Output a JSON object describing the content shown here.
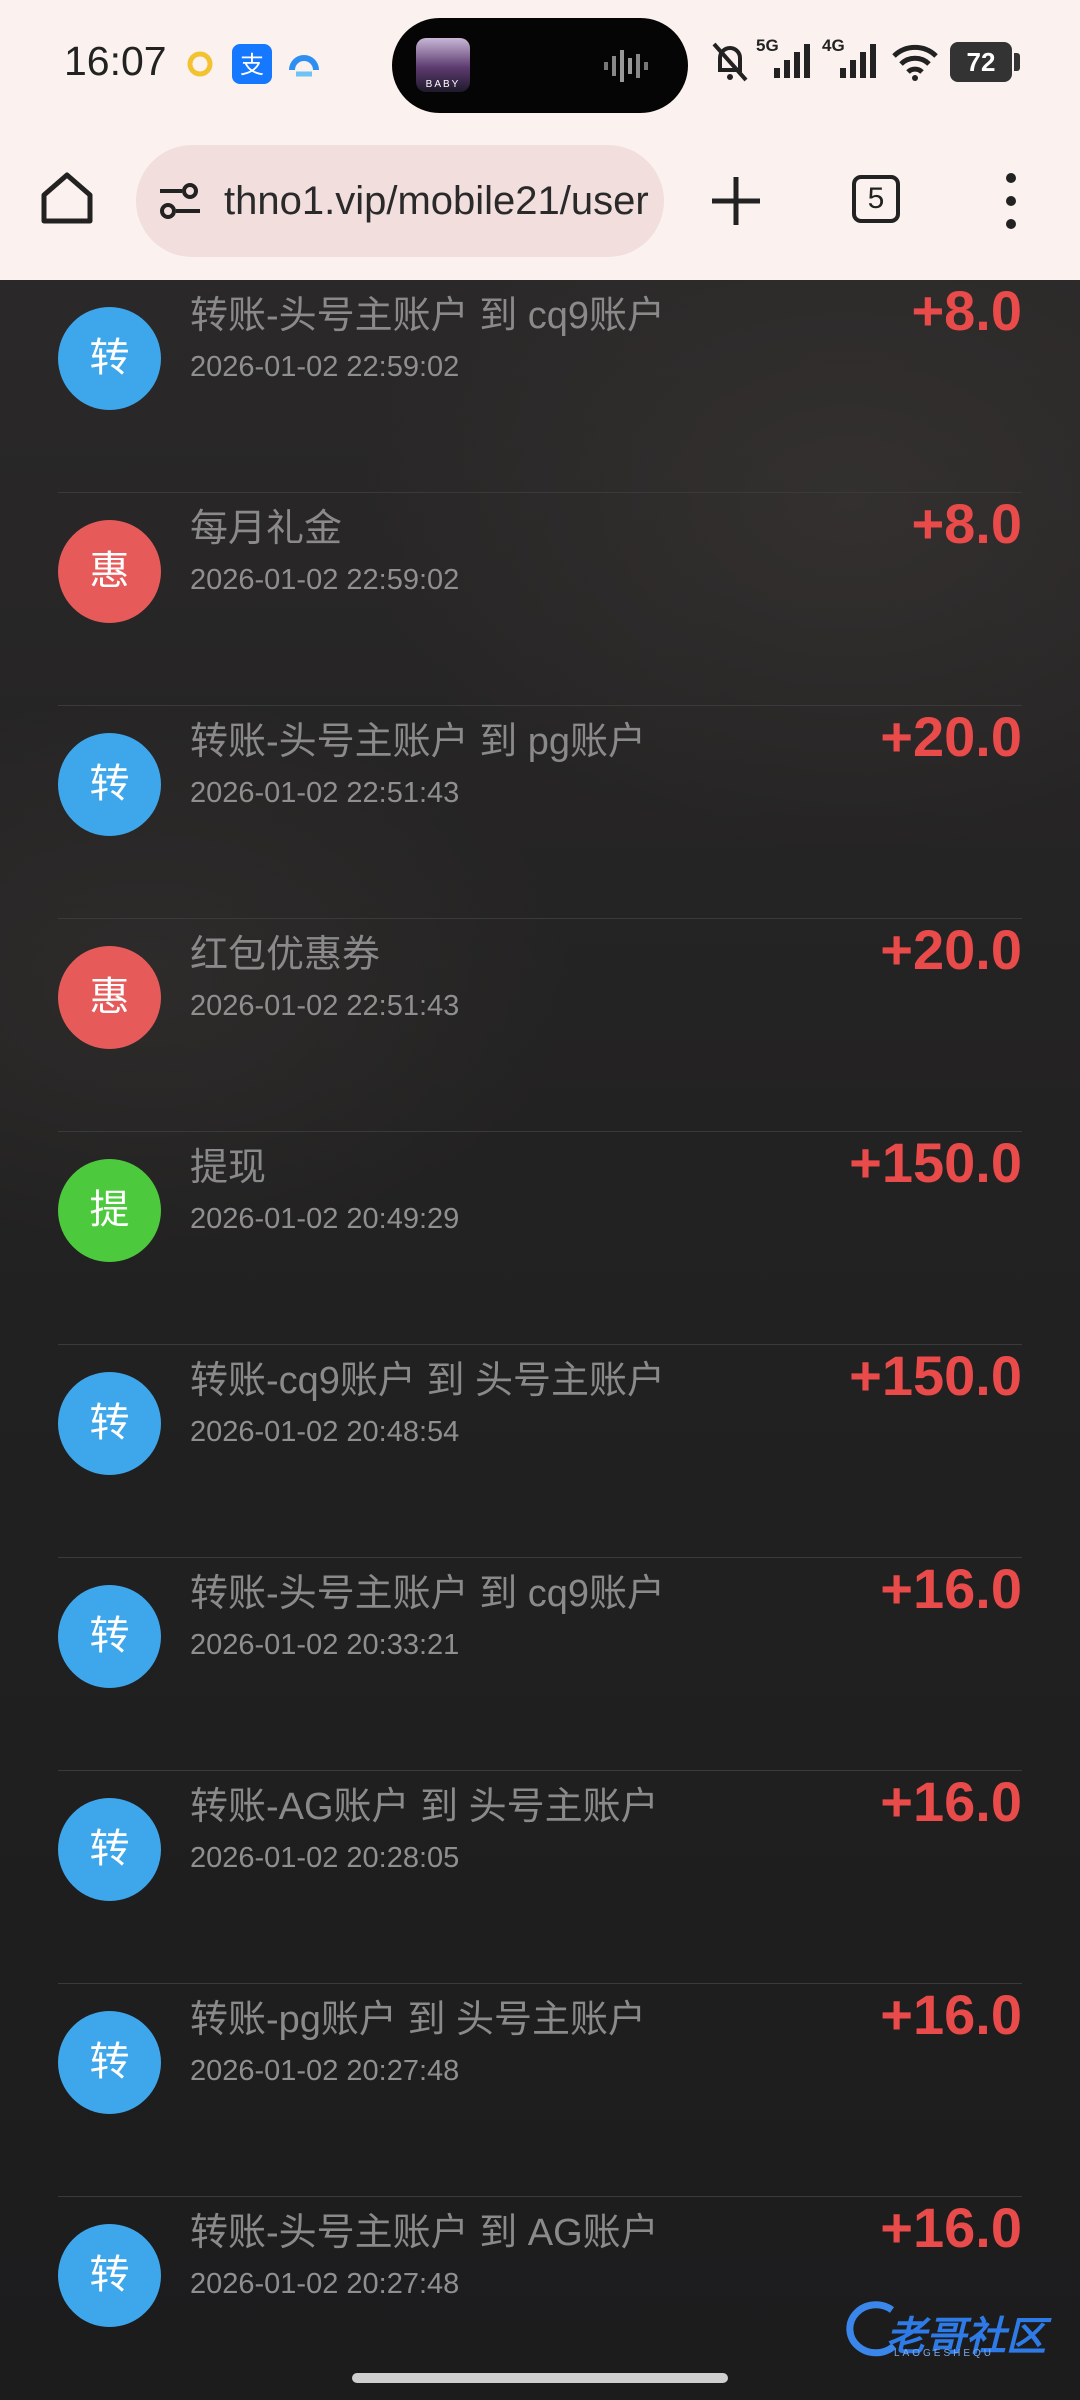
{
  "status_bar": {
    "time": "16:07",
    "island_thumb_label": "BABY",
    "network_1": "5G",
    "network_2": "4G",
    "battery": "72"
  },
  "browser": {
    "url": "thno1.vip/mobile21/user",
    "tab_count": "5"
  },
  "colors": {
    "transfer": "#3ea6ea",
    "promo": "#e65a5a",
    "withdraw": "#4cc93c",
    "amount": "#e94a4a"
  },
  "transactions": [
    {
      "icon": "转",
      "type": "transfer",
      "title": "转账-头号主账户 到 cq9账户",
      "time": "2026-01-02 22:59:02",
      "amount": "+8.0"
    },
    {
      "icon": "惠",
      "type": "promo",
      "title": "每月礼金",
      "time": "2026-01-02 22:59:02",
      "amount": "+8.0"
    },
    {
      "icon": "转",
      "type": "transfer",
      "title": "转账-头号主账户 到 pg账户",
      "time": "2026-01-02 22:51:43",
      "amount": "+20.0"
    },
    {
      "icon": "惠",
      "type": "promo",
      "title": "红包优惠券",
      "time": "2026-01-02 22:51:43",
      "amount": "+20.0"
    },
    {
      "icon": "提",
      "type": "withdraw",
      "title": "提现",
      "time": "2026-01-02 20:49:29",
      "amount": "+150.0"
    },
    {
      "icon": "转",
      "type": "transfer",
      "title": "转账-cq9账户 到 头号主账户",
      "time": "2026-01-02 20:48:54",
      "amount": "+150.0"
    },
    {
      "icon": "转",
      "type": "transfer",
      "title": "转账-头号主账户 到 cq9账户",
      "time": "2026-01-02 20:33:21",
      "amount": "+16.0"
    },
    {
      "icon": "转",
      "type": "transfer",
      "title": "转账-AG账户 到 头号主账户",
      "time": "2026-01-02 20:28:05",
      "amount": "+16.0"
    },
    {
      "icon": "转",
      "type": "transfer",
      "title": "转账-pg账户 到 头号主账户",
      "time": "2026-01-02 20:27:48",
      "amount": "+16.0"
    },
    {
      "icon": "转",
      "type": "transfer",
      "title": "转账-头号主账户 到 AG账户",
      "time": "2026-01-02 20:27:48",
      "amount": "+16.0"
    }
  ],
  "watermark": {
    "text": "老哥社区",
    "sub": "LAOGESHEQU"
  }
}
